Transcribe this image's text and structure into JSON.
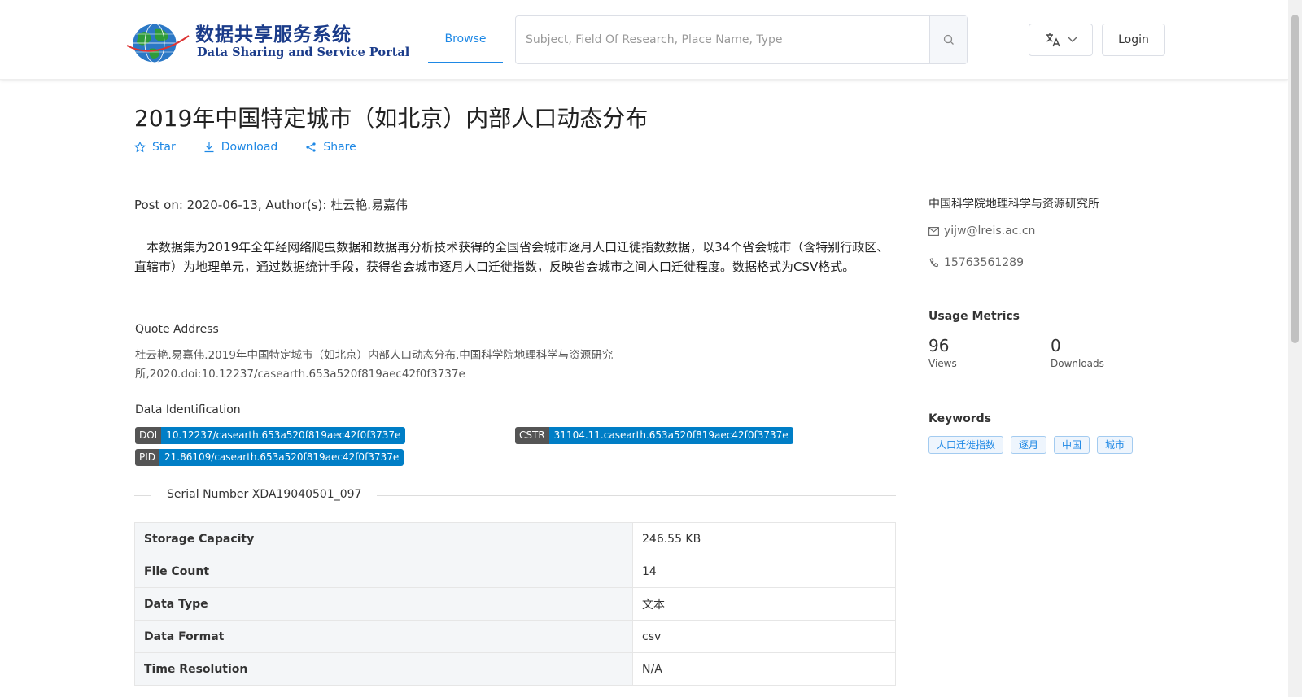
{
  "header": {
    "logo": {
      "name_cn": "数据共享服务系统",
      "name_en": "Data Sharing and Service Portal",
      "colors": [
        "#1b3c8a",
        "#2e9b3a",
        "#1e88e5"
      ]
    },
    "nav": {
      "browse": "Browse"
    },
    "search": {
      "placeholder": "Subject, Field Of Research, Place Name, Type",
      "icon": "search-icon"
    },
    "language_icon": "translate-icon",
    "login": "Login"
  },
  "dataset": {
    "title": "2019年中国特定城市（如北京）内部人口动态分布",
    "actions": {
      "star": "Star",
      "download": "Download",
      "share": "Share"
    },
    "post_line": "Post on: 2020-06-13, Author(s): 杜云艳.易嘉伟",
    "description": "　本数据集为2019年全年经网络爬虫数据和数据再分析技术获得的全国省会城市逐月人口迁徙指数数据，以34个省会城市（含特别行政区、直辖市）为地理单元，通过数据统计手段，获得省会城市逐月人口迁徙指数，反映省会城市之间人口迁徙程度。数据格式为CSV格式。",
    "quote": {
      "label": "Quote Address",
      "text": "杜云艳.易嘉伟.2019年中国特定城市（如北京）内部人口动态分布,中国科学院地理科学与资源研究所,2020.doi:10.12237/casearth.653a520f819aec42f0f3737e"
    },
    "identification": {
      "label": "Data Identification",
      "doi": {
        "key": "DOI",
        "value": "10.12237/casearth.653a520f819aec42f0f3737e"
      },
      "cstr": {
        "key": "CSTR",
        "value": "31104.11.casearth.653a520f819aec42f0f3737e"
      },
      "pid": {
        "key": "PID",
        "value": "21.86109/casearth.653a520f819aec42f0f3737e"
      }
    },
    "serial": "Serial Number XDA19040501_097",
    "metadata": [
      {
        "key": "Storage Capacity",
        "value": "246.55 KB"
      },
      {
        "key": "File Count",
        "value": "14"
      },
      {
        "key": "Data Type",
        "value": "文本"
      },
      {
        "key": "Data Format",
        "value": "csv"
      },
      {
        "key": "Time Resolution",
        "value": "N/A"
      }
    ]
  },
  "sidebar": {
    "organization": "中国科学院地理科学与资源研究所",
    "email": "yijw@lreis.ac.cn",
    "phone": "15763561289",
    "usage": {
      "title": "Usage Metrics",
      "views": {
        "count": "96",
        "label": "Views"
      },
      "downloads": {
        "count": "0",
        "label": "Downloads"
      }
    },
    "keywords": {
      "title": "Keywords",
      "items": [
        "人口迁徙指数",
        "逐月",
        "中国",
        "城市"
      ]
    }
  },
  "colors": {
    "accent": "#1e88e5",
    "badge_key": "#555555",
    "badge_value": "#007ec6"
  }
}
